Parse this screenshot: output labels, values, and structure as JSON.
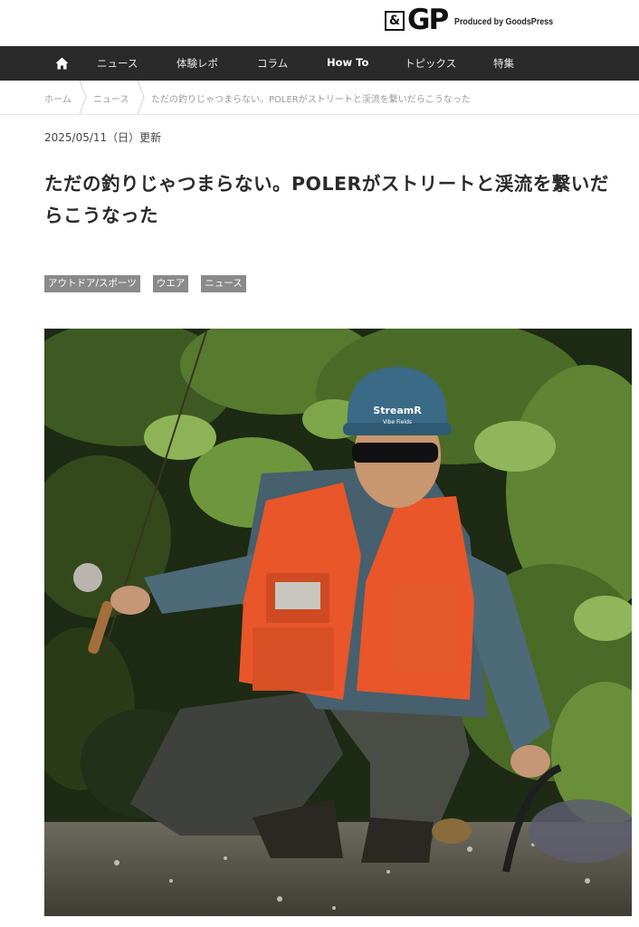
{
  "header": {
    "logo_amp": "&",
    "logo_gp": "GP",
    "produced_by": "Produced by GoodsPress"
  },
  "nav": {
    "home_icon": "home-icon",
    "items": [
      {
        "label": "ニュース"
      },
      {
        "label": "体験レポ"
      },
      {
        "label": "コラム"
      },
      {
        "label": "How To"
      },
      {
        "label": "トピックス"
      },
      {
        "label": "特集"
      }
    ]
  },
  "breadcrumb": {
    "items": [
      "ホーム",
      "ニュース",
      "ただの釣りじゃつまらない。POLERがストリートと渓流を繋いだらこうなった"
    ]
  },
  "article": {
    "date": "2025/05/11（日）更新",
    "title": "ただの釣りじゃつまらない。POLERがストリートと渓流を繋いだらこうなった",
    "tags": [
      "アウトドア/スポーツ",
      "ウエア",
      "ニュース"
    ],
    "hero": {
      "cap_text": "StreamR",
      "cap_subtext": "Vibe Fields"
    }
  },
  "colors": {
    "nav_bg": "#2a2a2a",
    "tag_bg": "#8a8a8a",
    "vest": "#e8562a",
    "cap": "#3a6a86"
  }
}
